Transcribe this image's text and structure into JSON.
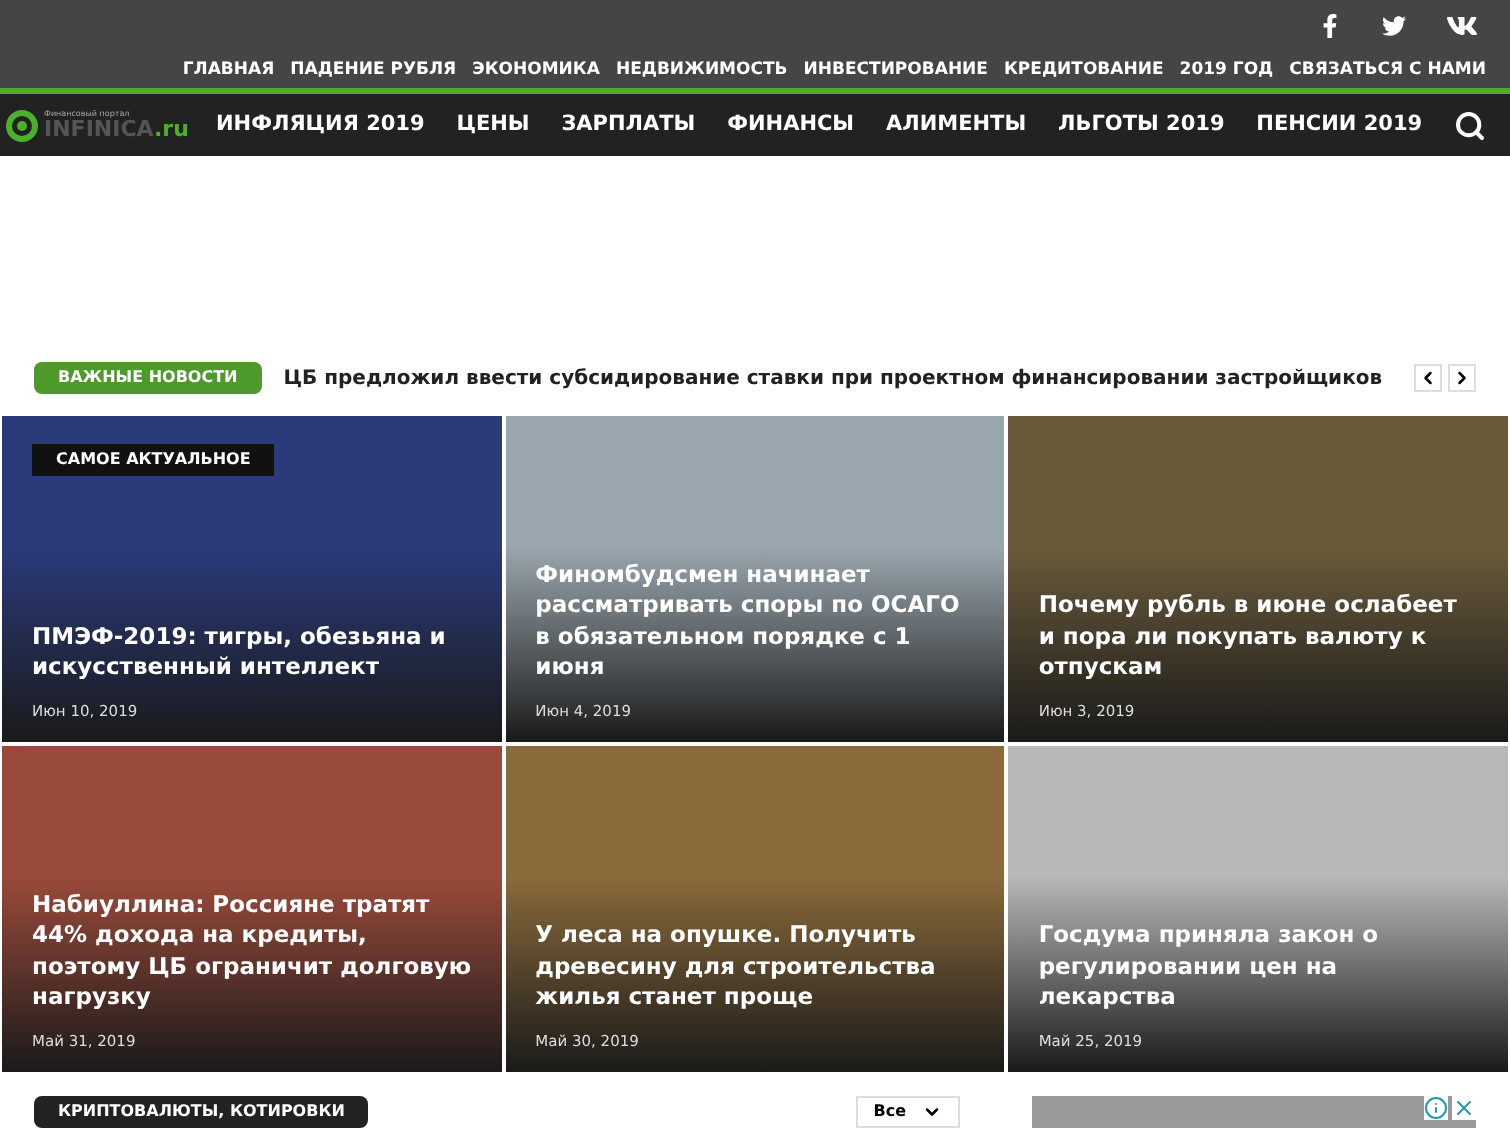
{
  "top_menu": [
    {
      "label": "ГЛАВНАЯ"
    },
    {
      "label": "ПАДЕНИЕ РУБЛЯ"
    },
    {
      "label": "ЭКОНОМИКА"
    },
    {
      "label": "НЕДВИЖИМОСТЬ"
    },
    {
      "label": "ИНВЕСТИРОВАНИЕ"
    },
    {
      "label": "КРЕДИТОВАНИЕ"
    },
    {
      "label": "2019 ГОД"
    },
    {
      "label": "СВЯЗАТЬСЯ С НАМИ"
    }
  ],
  "logo": {
    "tagline": "Финансовый портал",
    "name": "INFINICA",
    "suffix": ".ru"
  },
  "main_menu": [
    {
      "label": "ИНФЛЯЦИЯ 2019"
    },
    {
      "label": "ЦЕНЫ"
    },
    {
      "label": "ЗАРПЛАТЫ"
    },
    {
      "label": "ФИНАНСЫ"
    },
    {
      "label": "АЛИМЕНТЫ"
    },
    {
      "label": "ЛЬГОТЫ 2019"
    },
    {
      "label": "ПЕНСИИ 2019"
    }
  ],
  "ticker": {
    "badge": "ВАЖНЫЕ НОВОСТИ",
    "headline": "ЦБ предложил ввести субсидирование ставки при проектном финансировании застройщиков"
  },
  "tiles": [
    {
      "badge": "САМОЕ АКТУАЛЬНОЕ",
      "title": "ПМЭФ-2019: тигры, обезьяна и искусственный интеллект",
      "date": "Июн 10, 2019"
    },
    {
      "title": "Финомбудсмен начинает рассматривать споры по ОСАГО в обязательном порядке с 1 июня",
      "date": "Июн 4, 2019"
    },
    {
      "title": "Почему рубль в июне ослабеет и пора ли покупать валюту к отпускам",
      "date": "Июн 3, 2019"
    },
    {
      "title": "Набиуллина: Россияне тратят 44% дохода на кредиты, поэтому ЦБ ограничит долговую нагрузку",
      "date": "Май 31, 2019"
    },
    {
      "title": "У леса на опушке. Получить древесину для строительства жилья станет проще",
      "date": "Май 30, 2019"
    },
    {
      "title": "Госдума приняла закон о регулировании цен на лекарства",
      "date": "Май 25, 2019"
    }
  ],
  "section": {
    "badge": "КРИПТОВАЛЮТЫ, КОТИРОВКИ",
    "filter": "Все"
  }
}
